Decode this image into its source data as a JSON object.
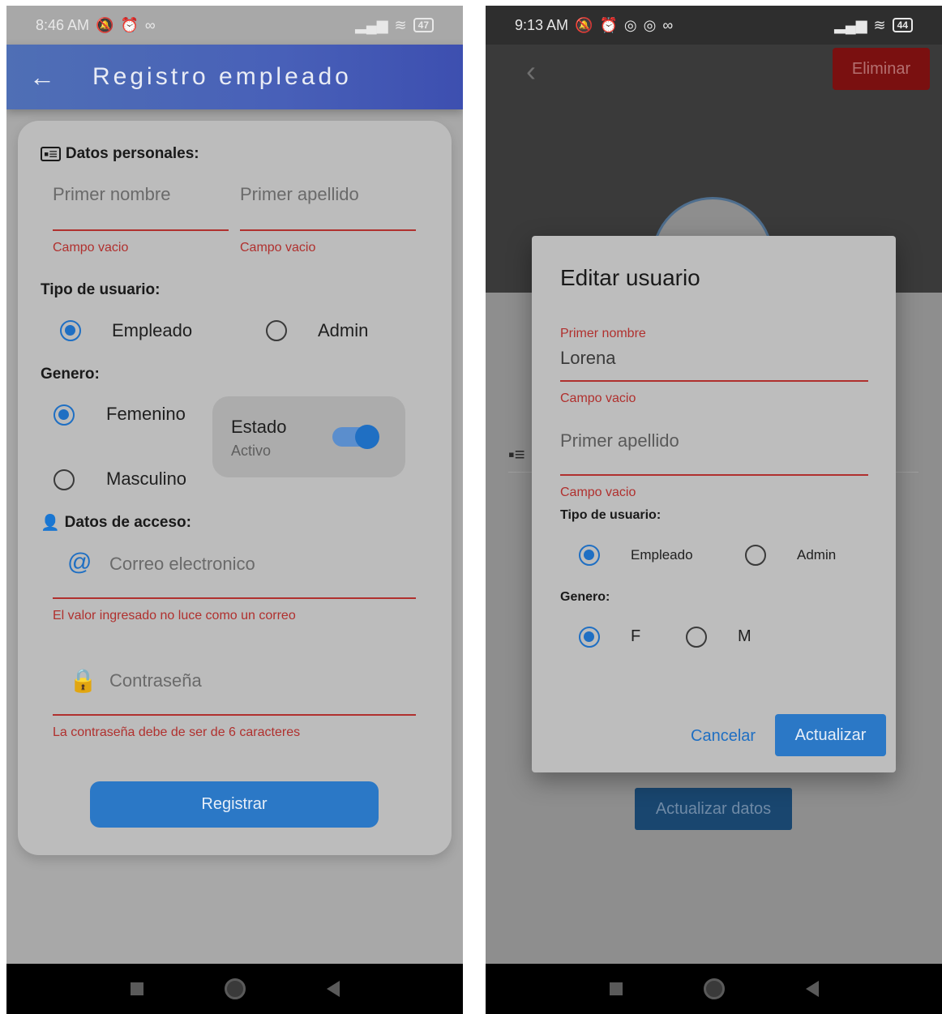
{
  "left_screen": {
    "status_bar": {
      "time": "8:46 AM",
      "battery": "47"
    },
    "app_bar": {
      "back_icon": "arrow-left-icon",
      "title": "Registro empleado"
    },
    "personal": {
      "heading": "Datos personales:",
      "first_name_placeholder": "Primer nombre",
      "last_name_placeholder": "Primer apellido",
      "first_name_error": "Campo vacio",
      "last_name_error": "Campo vacio"
    },
    "user_type": {
      "heading": "Tipo de usuario:",
      "options": [
        "Empleado",
        "Admin"
      ],
      "selected": "Empleado"
    },
    "gender": {
      "heading": "Genero:",
      "options": [
        "Femenino",
        "Masculino"
      ],
      "selected": "Femenino"
    },
    "estado": {
      "title": "Estado",
      "subtitle": "Activo",
      "enabled": true
    },
    "access": {
      "heading": "Datos de acceso:",
      "email_placeholder": "Correo electronico",
      "email_error": "El valor ingresado no luce como un correo",
      "password_placeholder": "Contraseña",
      "password_error": "La contraseña debe de ser de 6 caracteres"
    },
    "register_button": "Registrar"
  },
  "right_screen": {
    "status_bar": {
      "time": "9:13 AM",
      "battery": "44"
    },
    "delete_button": "Eliminar",
    "background_update_button": "Actualizar datos",
    "dialog": {
      "title": "Editar usuario",
      "first_name_label": "Primer nombre",
      "first_name_value": "Lorena",
      "first_name_error": "Campo vacio",
      "last_name_placeholder": "Primer apellido",
      "last_name_error": "Campo vacio",
      "user_type_heading": "Tipo de usuario:",
      "user_type_options": [
        "Empleado",
        "Admin"
      ],
      "user_type_selected": "Empleado",
      "gender_heading": "Genero:",
      "gender_options": [
        "F",
        "M"
      ],
      "gender_selected": "F",
      "cancel_button": "Cancelar",
      "update_button": "Actualizar"
    }
  },
  "colors": {
    "accent": "#1f6fc3",
    "error": "#b0302e",
    "danger": "#7a1010"
  }
}
